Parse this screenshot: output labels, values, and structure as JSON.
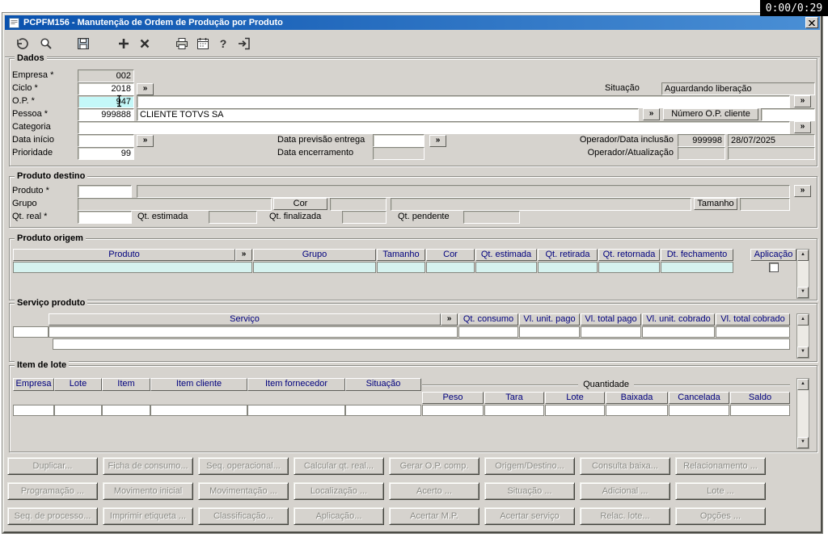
{
  "overlay": {
    "timer_text": "0:00/0:29"
  },
  "window": {
    "title": "PCPFM156 - Manutenção de Ordem de Produção por Produto"
  },
  "toolbar": {
    "icons": [
      "undo",
      "search",
      "save",
      "add",
      "delete",
      "print",
      "calendar",
      "help",
      "exit"
    ]
  },
  "ui": {
    "lookup_glyph": "»",
    "scroll_up_glyph": "▲",
    "scroll_down_glyph": "▼"
  },
  "colors": {
    "window_bg": "#d6d3ce",
    "titlebar_start": "#0a52ae",
    "titlebar_end": "#4a8fd5",
    "highlight_field": "#c4f8f8",
    "grid_row_highlight": "#d6f2ef",
    "grid_header_text": "#00007e"
  },
  "dados": {
    "legend": "Dados",
    "empresa": {
      "label": "Empresa *",
      "value": "002"
    },
    "ciclo": {
      "label": "Ciclo *",
      "value": "2018"
    },
    "situacao": {
      "label": "Situação",
      "value": "Aguardando liberação"
    },
    "op": {
      "label": "O.P. *",
      "value": "947",
      "descricao": ""
    },
    "pessoa": {
      "label": "Pessoa *",
      "value": "999888",
      "nome": "CLIENTE TOTVS SA"
    },
    "numero_op_cliente": {
      "label": "Número O.P. cliente",
      "value": ""
    },
    "categoria": {
      "label": "Categoria",
      "value": ""
    },
    "data_inicio": {
      "label": "Data início",
      "value": ""
    },
    "data_previsao_entrega": {
      "label": "Data previsão entrega",
      "value": ""
    },
    "operador_data_inclusao": {
      "label": "Operador/Data inclusão",
      "operador": "999998",
      "data": "28/07/2025"
    },
    "prioridade": {
      "label": "Prioridade",
      "value": "99"
    },
    "data_encerramento": {
      "label": "Data encerramento",
      "value": ""
    },
    "operador_atualizacao": {
      "label": "Operador/Atualização",
      "operador": "",
      "data": ""
    }
  },
  "produto_destino": {
    "legend": "Produto destino",
    "produto": {
      "label": "Produto *",
      "codigo": "",
      "descricao": ""
    },
    "grupo": {
      "label": "Grupo",
      "value": ""
    },
    "cor": {
      "label": "Cor",
      "value": ""
    },
    "tamanho": {
      "label": "Tamanho",
      "value": ""
    },
    "qt_real": {
      "label": "Qt. real *",
      "value": ""
    },
    "qt_estimada": {
      "label": "Qt. estimada",
      "value": ""
    },
    "qt_finalizada": {
      "label": "Qt. finalizada",
      "value": ""
    },
    "qt_pendente": {
      "label": "Qt. pendente",
      "value": ""
    }
  },
  "produto_origem": {
    "legend": "Produto origem",
    "headers": [
      "Produto",
      "Grupo",
      "Tamanho",
      "Cor",
      "Qt. estimada",
      "Qt. retirada",
      "Qt. retornada",
      "Dt. fechamento",
      "Aplicação"
    ],
    "rows": [
      {
        "produto": "",
        "grupo": "",
        "tamanho": "",
        "cor": "",
        "qt_estimada": "",
        "qt_retirada": "",
        "qt_retornada": "",
        "dt_fechamento": "",
        "aplicacao_checked": false
      }
    ]
  },
  "servico_produto": {
    "legend": "Serviço produto",
    "headers": [
      "Serviço",
      "Qt. consumo",
      "Vl. unit. pago",
      "Vl. total pago",
      "Vl. unit. cobrado",
      "Vl. total cobrado"
    ]
  },
  "item_de_lote": {
    "legend": "Item de lote",
    "headers": [
      "Empresa",
      "Lote",
      "Item",
      "Item cliente",
      "Item fornecedor",
      "Situação"
    ],
    "quantidade": {
      "label": "Quantidade",
      "headers": [
        "Peso",
        "Tara",
        "Lote",
        "Baixada",
        "Cancelada",
        "Saldo"
      ]
    }
  },
  "action_buttons": {
    "rows": [
      [
        "Duplicar...",
        "Ficha de consumo...",
        "Seq. operacional...",
        "Calcular qt. real...",
        "Gerar O.P. comp.",
        "Origem/Destino...",
        "Consulta baixa...",
        "Relacionamento ..."
      ],
      [
        "Programação ...",
        "Movimento inicial",
        "Movimentação ...",
        "Localização ...",
        "Acerto ...",
        "Situação ...",
        "Adicional ...",
        "Lote ..."
      ],
      [
        "Seq. de processo...",
        "Imprimir etiqueta ...",
        "Classificação...",
        "Aplicação...",
        "Acertar M.P.",
        "Acertar serviço",
        "Relac. lote...",
        "Opções ..."
      ]
    ]
  }
}
